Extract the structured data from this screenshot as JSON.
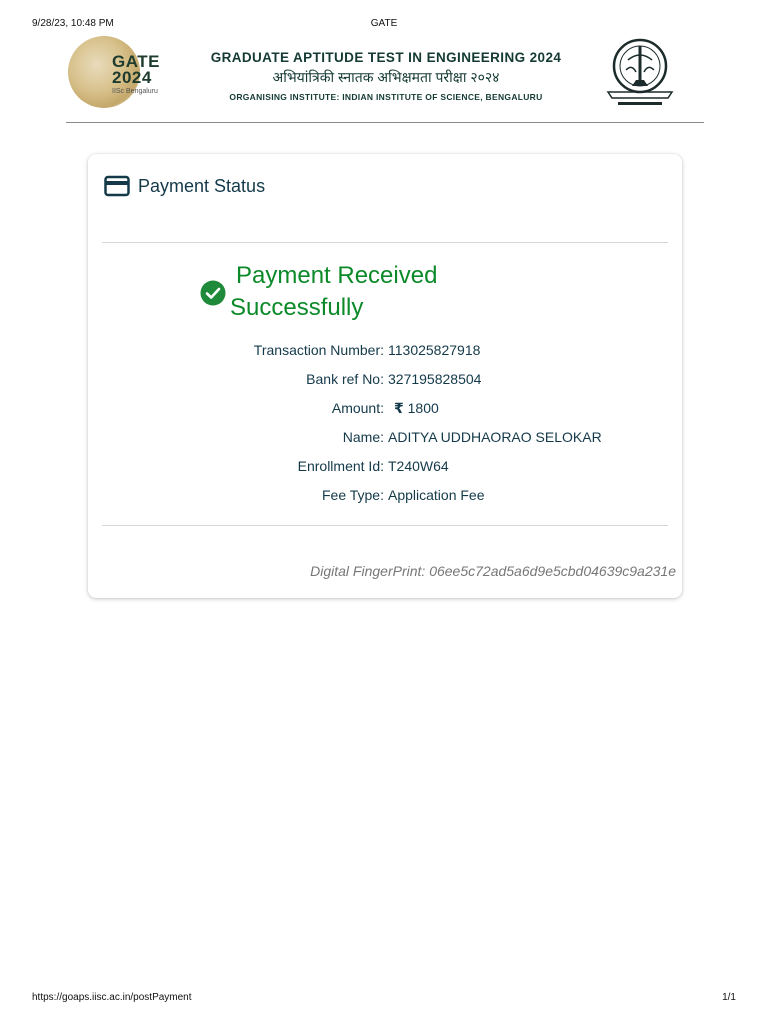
{
  "print": {
    "datetime": "9/28/23, 10:48 PM",
    "title": "GATE",
    "url": "https://goaps.iisc.ac.in/postPayment",
    "page": "1/1"
  },
  "banner": {
    "logo_text_line1": "GATE",
    "logo_text_line2": "2024",
    "logo_sub": "IISc Bengaluru",
    "title": "GRADUATE APTITUDE TEST IN ENGINEERING 2024",
    "hindi": "अभियांत्रिकी स्नातक अभिक्षमता परीक्षा २०२४",
    "organiser": "ORGANISING INSTITUTE: INDIAN INSTITUTE OF SCIENCE, BENGALURU"
  },
  "card": {
    "title": "Payment Status",
    "success_line1": "Payment Received",
    "success_line2": "Successfully",
    "details": [
      {
        "label": "Transaction Number:",
        "value": "113025827918"
      },
      {
        "label": "Bank ref No:",
        "value": "327195828504"
      },
      {
        "label": "Amount:",
        "currency": "₹",
        "value": "1800"
      },
      {
        "label": "Name:",
        "value": "ADITYA UDDHAORAO SELOKAR"
      },
      {
        "label": "Enrollment Id:",
        "value": "T240W64"
      },
      {
        "label": "Fee Type:",
        "value": "Application Fee"
      }
    ],
    "fingerprint_label": "Digital FingerPrint:",
    "fingerprint_value": "06ee5c72ad5a6d9e5cbd04639c9a231e"
  },
  "colors": {
    "success": "#0c8a2a",
    "heading": "#143a4a",
    "banner_text": "#143a33"
  },
  "icons": {
    "card": "credit-card-icon",
    "success": "check-circle-icon"
  }
}
